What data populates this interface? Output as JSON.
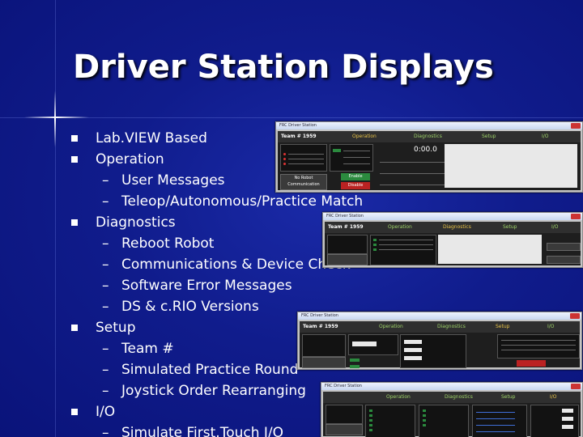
{
  "slide": {
    "title": "Driver Station Displays",
    "bullets": [
      {
        "level": 1,
        "text": "Lab.VIEW Based"
      },
      {
        "level": 1,
        "text": "Operation"
      },
      {
        "level": 2,
        "text": "User Messages"
      },
      {
        "level": 2,
        "text": "Teleop/Autonomous/Practice Match"
      },
      {
        "level": 1,
        "text": "Diagnostics"
      },
      {
        "level": 2,
        "text": "Reboot Robot"
      },
      {
        "level": 2,
        "text": "Communications & Device Check"
      },
      {
        "level": 2,
        "text": "Software Error Messages"
      },
      {
        "level": 2,
        "text": "DS & c.RIO Versions"
      },
      {
        "level": 1,
        "text": "Setup"
      },
      {
        "level": 2,
        "text": "Team #"
      },
      {
        "level": 2,
        "text": "Simulated Practice Round"
      },
      {
        "level": 2,
        "text": "Joystick Order Rearranging"
      },
      {
        "level": 1,
        "text": "I/O"
      },
      {
        "level": 2,
        "text": "Simulate First.Touch I/O"
      }
    ],
    "dash": "–"
  },
  "screenshots": {
    "operation": {
      "window_title": "FRC Driver Station",
      "team": "Team # 1959",
      "active_tab": "Operation",
      "tabs": [
        "Operation",
        "Diagnostics",
        "Setup",
        "I/O"
      ],
      "elapsed": "0:00.0",
      "enable": "Enable",
      "disable": "Disable",
      "no_comm": "No Robot Communication"
    },
    "diagnostics": {
      "window_title": "FRC Driver Station",
      "team": "Team # 1959",
      "active_tab": "Diagnostics",
      "tabs": [
        "Operation",
        "Diagnostics",
        "Setup",
        "I/O"
      ]
    },
    "setup": {
      "window_title": "FRC Driver Station",
      "team": "Team # 1959",
      "active_tab": "Setup",
      "tabs": [
        "Operation",
        "Diagnostics",
        "Setup",
        "I/O"
      ]
    },
    "io": {
      "window_title": "FRC Driver Station",
      "active_tab": "I/O",
      "tabs": [
        "Operation",
        "Diagnostics",
        "Setup",
        "I/O"
      ]
    }
  }
}
